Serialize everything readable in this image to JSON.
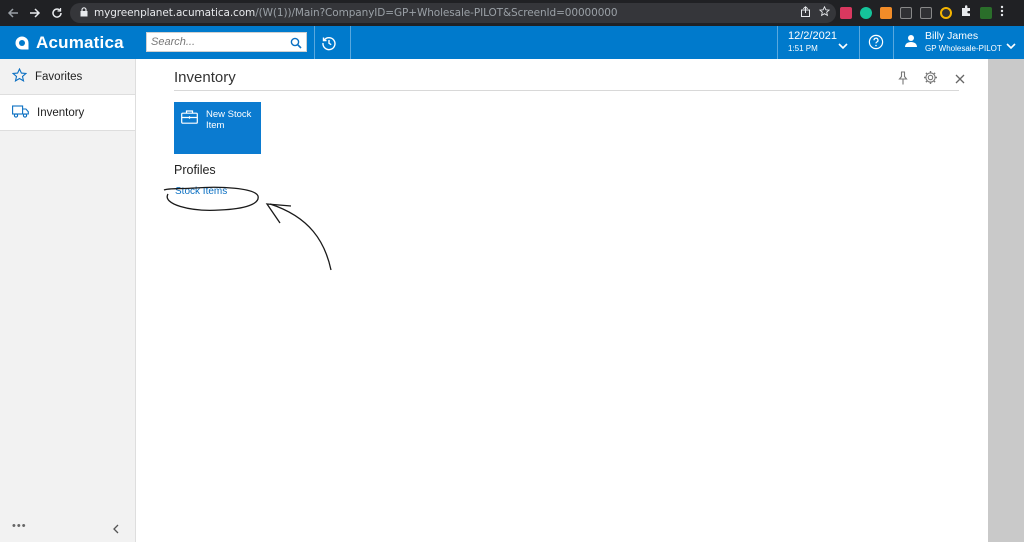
{
  "browser": {
    "url_host": "mygreenplanet.acumatica.com",
    "url_path": "/(W(1))/Main?CompanyID=GP+Wholesale-PILOT&ScreenId=00000000"
  },
  "header": {
    "logo_text": "Acumatica",
    "search_placeholder": "Search...",
    "date": "12/2/2021",
    "time": "1:51 PM",
    "user_name": "Billy James",
    "user_company": "GP Wholesale-PILOT"
  },
  "sidebar": {
    "items": [
      {
        "label": "Favorites",
        "icon": "star-icon"
      },
      {
        "label": "Inventory",
        "icon": "truck-icon"
      }
    ],
    "more_label": "•••"
  },
  "workspace": {
    "title": "Inventory",
    "tiles": [
      {
        "label": "New Stock Item",
        "icon": "briefcase-icon"
      }
    ],
    "sections": [
      {
        "title": "Profiles",
        "links": [
          "Stock Items"
        ]
      }
    ]
  },
  "colors": {
    "header_bg": "#007acc",
    "tile_bg": "#0b7bd0",
    "link": "#0a6fc2",
    "browser_bg": "#202124"
  }
}
